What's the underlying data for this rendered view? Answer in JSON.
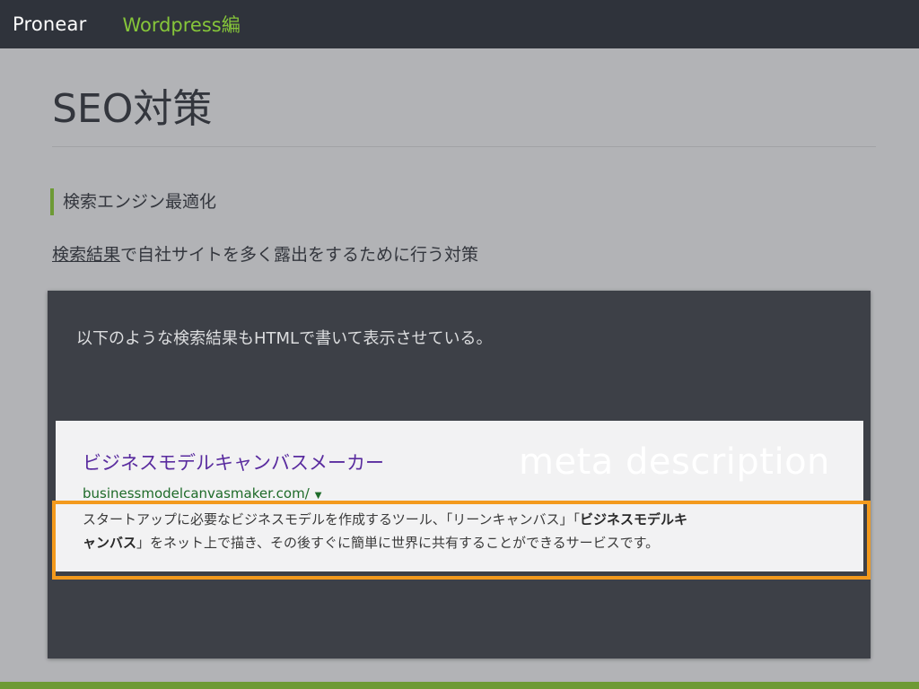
{
  "header": {
    "brand": "Pronear",
    "nav_link": "Wordpress編"
  },
  "page": {
    "title": "SEO対策",
    "section_heading": "検索エンジン最適化",
    "lead_underlined": "検索結果",
    "lead_rest": "で自社サイトを多く露出をするために行う対策"
  },
  "panel": {
    "text": "以下のような検索結果もHTMLで書いて表示させている。",
    "meta_label": "meta description"
  },
  "search_result": {
    "title": "ビジネスモデルキャンバスメーカー",
    "url": "businessmodelcanvasmaker.com/",
    "snippet_line1_plain": "スタートアップに必要なビジネスモデルを作成するツール、「リーンキャンバス」「",
    "snippet_line1_bold": "ビジネスモデルキ",
    "snippet_line2_bold": "ャンバス",
    "snippet_line2_plain": "」をネット上で描き、その後すぐに簡単に世界に共有することができるサービスです。"
  },
  "colors": {
    "accent_green": "#86c63a",
    "highlight_orange": "#f39a1d",
    "link_purple": "#5a2c9f",
    "url_green": "#1e6b2a"
  }
}
